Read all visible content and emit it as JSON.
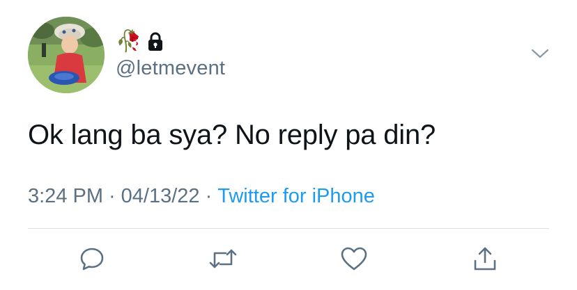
{
  "author": {
    "emoji_name": "🥀",
    "handle": "@letmevent",
    "protected": true
  },
  "tweet": {
    "text": "Ok lang ba sya? No reply pa din?",
    "time": "3:24 PM",
    "separator": "·",
    "date": "04/13/22",
    "source": "Twitter for iPhone"
  },
  "colors": {
    "text": "#0f1419",
    "secondary": "#5b7083",
    "accent": "#1d9bf0",
    "icon": "#5b7083"
  },
  "icons": {
    "reply": "reply-icon",
    "retweet": "retweet-icon",
    "like": "heart-icon",
    "share": "share-icon",
    "more": "chevron-down-icon",
    "lock": "lock-icon"
  }
}
